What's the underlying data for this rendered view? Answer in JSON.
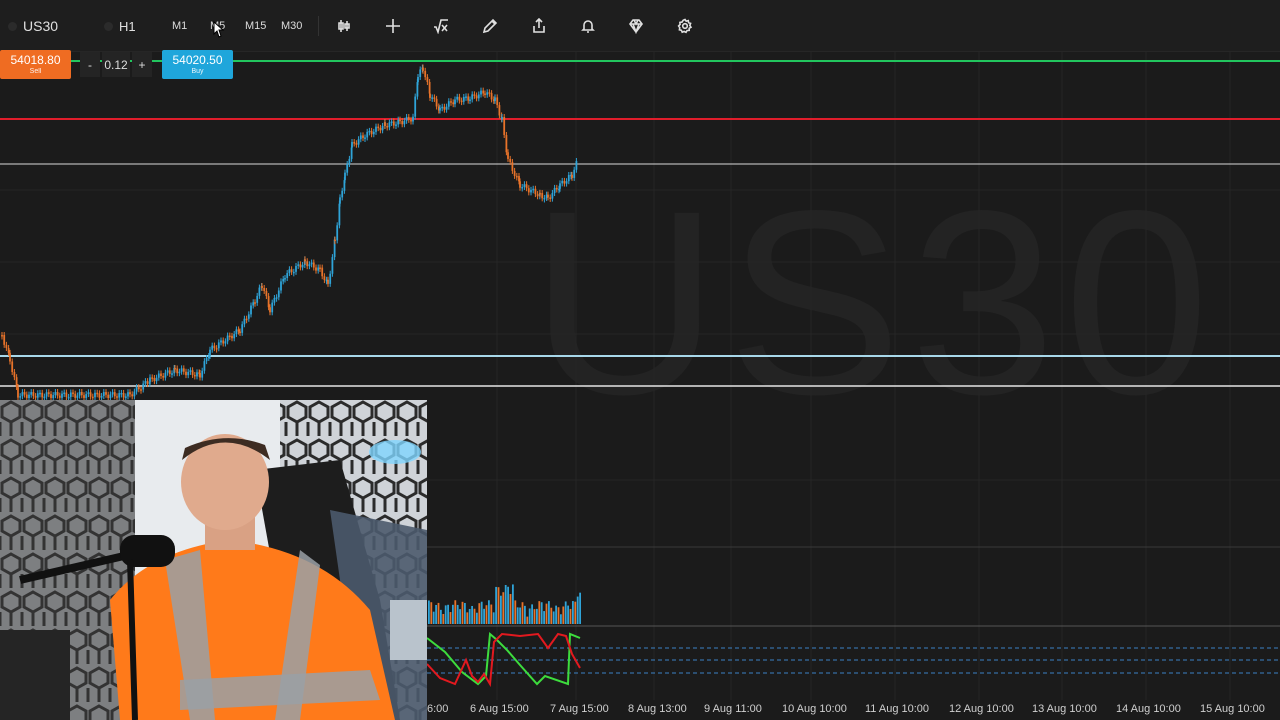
{
  "toolbar": {
    "symbol": "US30",
    "timeframe": "H1",
    "timeframes": [
      "M1",
      "M5",
      "M15",
      "M30"
    ]
  },
  "trade": {
    "sell_price": "54018.80",
    "sell_label": "Sell",
    "buy_price": "54020.50",
    "buy_label": "Buy",
    "minus": "-",
    "quantity": "0.12",
    "plus": "+"
  },
  "chart": {
    "watermark": "US30",
    "colors": {
      "up": "#2fa4d8",
      "down": "#e8732a",
      "resistance_green": "#22c55e",
      "resistance_red": "#e11d2b",
      "support_blue": "#a8d8ea",
      "white_line": "#d9d9d9",
      "osc_green": "#3ddc3d",
      "osc_red": "#e3191f"
    }
  },
  "time_axis": {
    "labels": [
      "6:00",
      "6 Aug 15:00",
      "7 Aug 15:00",
      "8 Aug 13:00",
      "9 Aug 11:00",
      "10 Aug 10:00",
      "11 Aug 10:00",
      "12 Aug 10:00",
      "13 Aug 10:00",
      "14 Aug 10:00",
      "15 Aug 10:00"
    ]
  }
}
